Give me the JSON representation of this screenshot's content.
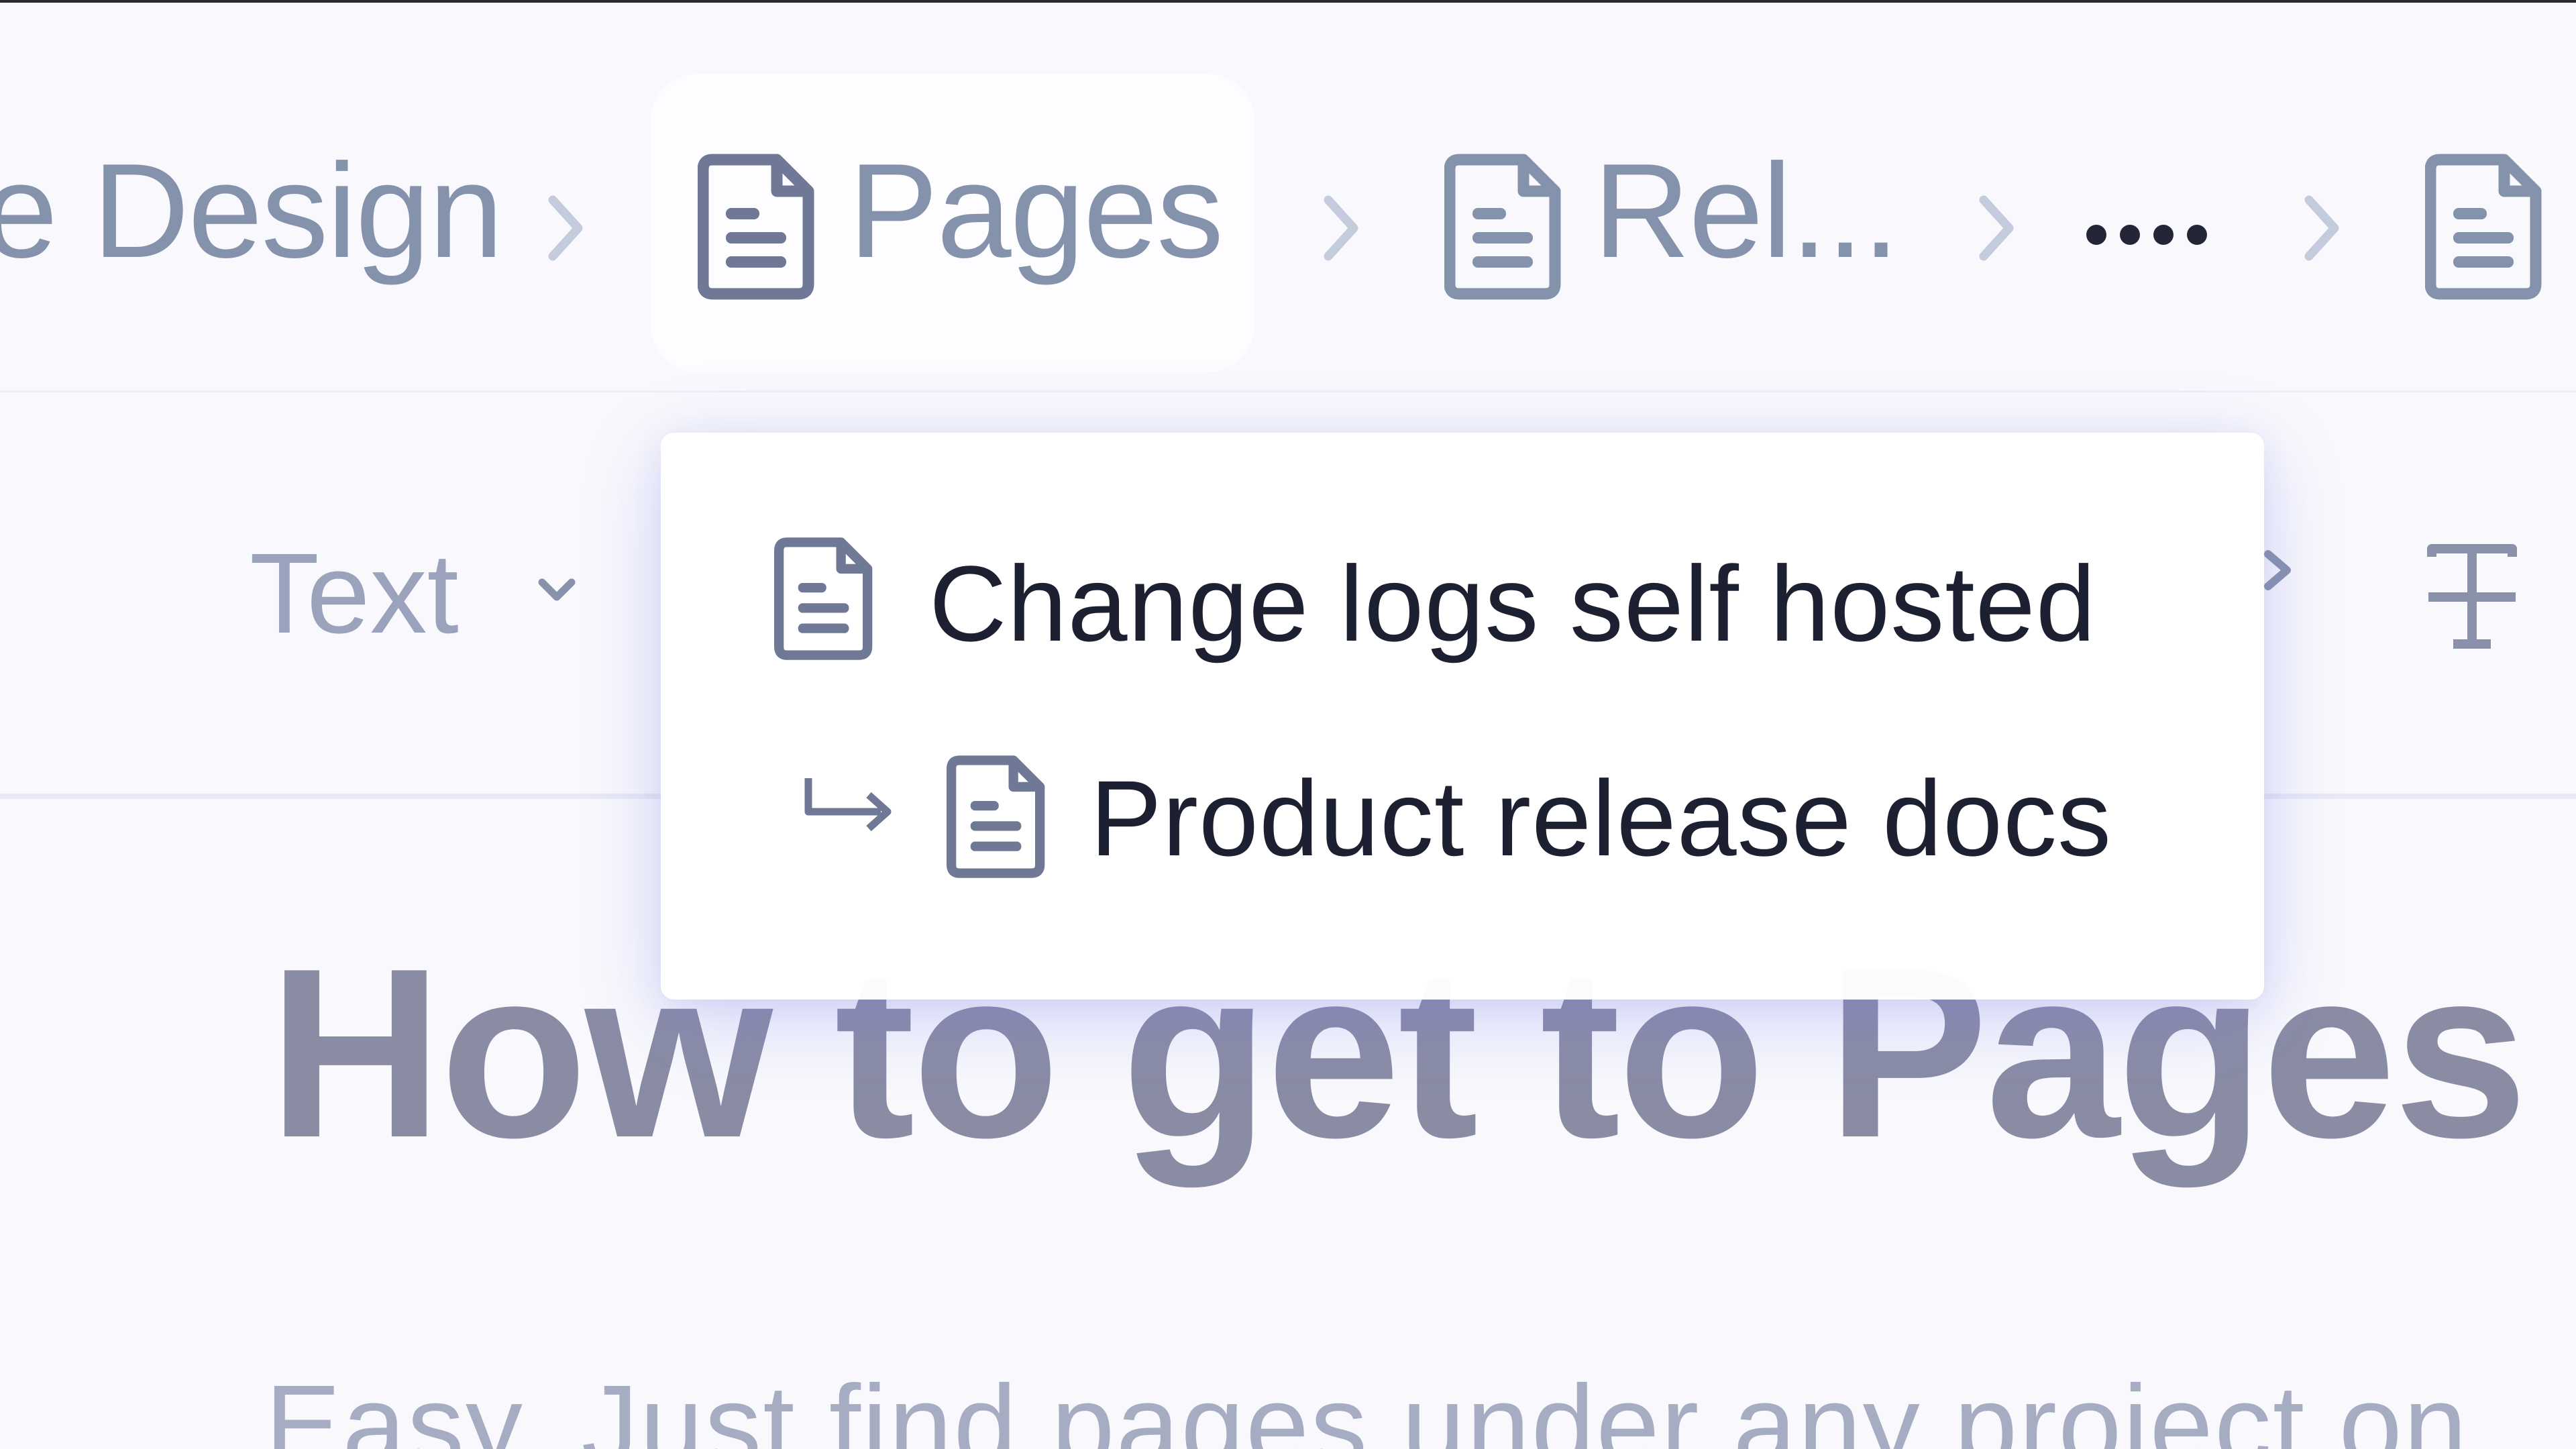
{
  "breadcrumb": {
    "items": [
      {
        "label": "e Design",
        "icon": "page-icon",
        "active": false
      },
      {
        "label": "Pages",
        "icon": "page-icon",
        "active": true
      },
      {
        "label": "Rel...",
        "icon": "page-icon",
        "active": false
      },
      {
        "label": "",
        "icon": "more-horizontal-icon",
        "active": false
      },
      {
        "label": "",
        "icon": "page-icon",
        "active": false
      }
    ]
  },
  "toolbar": {
    "text_style_label": "Text",
    "text_style_icon": "chevron-down-icon",
    "strikethrough_icon": "strikethrough-icon"
  },
  "dropdown": {
    "items": [
      {
        "label": "Change logs self hosted",
        "icon": "page-icon",
        "level": 0
      },
      {
        "label": "Product release docs",
        "icon": "page-icon",
        "level": 1,
        "prefix_icon": "child-arrow-icon"
      }
    ]
  },
  "page": {
    "title": "How to get to Pages",
    "body": "Easy. Just find pages under any project on"
  },
  "colors": {
    "background": "#f9f9fd",
    "crumb_text": "#8592ab",
    "icon": "#6f7894",
    "menu_text": "#1d2030",
    "title": "#8a8ca4"
  }
}
